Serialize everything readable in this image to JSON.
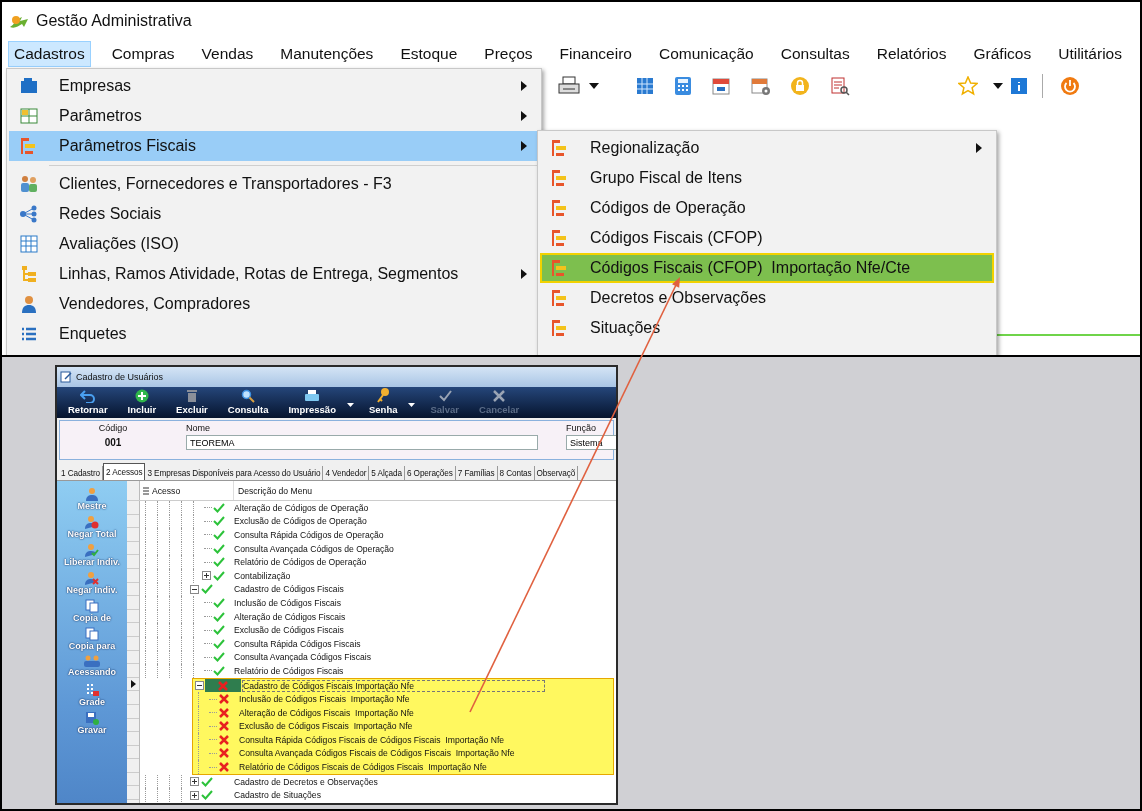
{
  "window": {
    "title": "Gestão Administrativa"
  },
  "menubar": [
    {
      "label": "Cadastros",
      "selected": true
    },
    {
      "label": "Compras",
      "selected": false
    },
    {
      "label": "Vendas",
      "selected": false
    },
    {
      "label": "Manutenções",
      "selected": false
    },
    {
      "label": "Estoque",
      "selected": false
    },
    {
      "label": "Preços",
      "selected": false
    },
    {
      "label": "Financeiro",
      "selected": false
    },
    {
      "label": "Comunicação",
      "selected": false
    },
    {
      "label": "Consultas",
      "selected": false
    },
    {
      "label": "Relatórios",
      "selected": false
    },
    {
      "label": "Gráficos",
      "selected": false
    },
    {
      "label": "Utilitários",
      "selected": false
    }
  ],
  "menu": {
    "items": [
      {
        "kind": "item",
        "label": "Empresas",
        "has_submenu": true,
        "selected": false
      },
      {
        "kind": "item",
        "label": "Parâmetros",
        "has_submenu": true,
        "selected": false
      },
      {
        "kind": "item",
        "label": "Parâmetros Fiscais",
        "has_submenu": true,
        "selected": true
      },
      {
        "kind": "separator"
      },
      {
        "kind": "item",
        "label": "Clientes, Fornecedores e Transportadores - F3",
        "has_submenu": false,
        "selected": false
      },
      {
        "kind": "item",
        "label": "Redes Sociais",
        "has_submenu": false,
        "selected": false
      },
      {
        "kind": "item",
        "label": "Avaliações (ISO)",
        "has_submenu": false,
        "selected": false
      },
      {
        "kind": "item",
        "label": "Linhas, Ramos Atividade, Rotas de Entrega, Segmentos",
        "has_submenu": true,
        "selected": false
      },
      {
        "kind": "item",
        "label": "Vendedores, Compradores",
        "has_submenu": false,
        "selected": false
      },
      {
        "kind": "item",
        "label": "Enquetes",
        "has_submenu": false,
        "selected": false
      }
    ]
  },
  "submenu": {
    "items": [
      {
        "kind": "item",
        "label": "Regionalização",
        "has_submenu": true,
        "selected": false
      },
      {
        "kind": "item",
        "label": "Grupo Fiscal de Itens",
        "has_submenu": false,
        "selected": false
      },
      {
        "kind": "item",
        "label": "Códigos de Operação",
        "has_submenu": false,
        "selected": false
      },
      {
        "kind": "item",
        "label": "Códigos Fiscais (CFOP)",
        "has_submenu": false,
        "selected": false
      },
      {
        "kind": "item",
        "label": "Códigos Fiscais (CFOP)  Importação Nfe/Cte",
        "has_submenu": false,
        "selected": true
      },
      {
        "kind": "item",
        "label": "Decretos e Observações",
        "has_submenu": false,
        "selected": false
      },
      {
        "kind": "item",
        "label": "Situações",
        "has_submenu": false,
        "selected": false
      }
    ]
  },
  "users_window": {
    "title": "Cadastro de Usuários",
    "toolbar": [
      {
        "label": "Retornar",
        "disabled": false,
        "dropdown": false
      },
      {
        "label": "Incluir",
        "disabled": false,
        "dropdown": false
      },
      {
        "label": "Excluir",
        "disabled": false,
        "dropdown": false
      },
      {
        "label": "Consulta",
        "disabled": false,
        "dropdown": false
      },
      {
        "label": "Impressão",
        "disabled": false,
        "dropdown": true
      },
      {
        "label": "Senha",
        "disabled": false,
        "dropdown": true
      },
      {
        "label": "Salvar",
        "disabled": true,
        "dropdown": false
      },
      {
        "label": "Cancelar",
        "disabled": true,
        "dropdown": false
      }
    ],
    "form": {
      "code_label": "Código",
      "code": "001",
      "name_label": "Nome",
      "name": "TEOREMA",
      "role_label": "Função",
      "role": "Sistema"
    },
    "tabs": [
      {
        "label": "1 Cadastro",
        "selected": false
      },
      {
        "label": "2 Acessos",
        "selected": true
      },
      {
        "label": "3 Empresas Disponíveis para Acesso do Usuário",
        "selected": false
      },
      {
        "label": "4 Vendedor",
        "selected": false
      },
      {
        "label": "5 Alçada",
        "selected": false
      },
      {
        "label": "6 Operações",
        "selected": false
      },
      {
        "label": "7 Famílias",
        "selected": false
      },
      {
        "label": "8 Contas",
        "selected": false
      },
      {
        "label": "Observaçõ",
        "selected": false
      }
    ],
    "actions": [
      "Mestre",
      "Negar Total",
      "Liberar Indiv.",
      "Negar Indiv.",
      "Copia de",
      "Copia para",
      "Acessando",
      "Grade",
      "Gravar"
    ],
    "grid": {
      "columns": [
        "Acesso",
        "Descrição do Menu"
      ],
      "tree": [
        {
          "kind": "continuation",
          "highlighted": false,
          "children": [
            {
              "kind": "node",
              "label": "Alteração de Códigos de Operação",
              "allowed": true,
              "selected": false
            },
            {
              "kind": "node",
              "label": "Exclusão de Códigos de Operação",
              "allowed": true,
              "selected": false
            },
            {
              "kind": "node",
              "label": "Consulta Rápida Códigos de Operação",
              "allowed": true,
              "selected": false
            },
            {
              "kind": "node",
              "label": "Consulta Avançada Códigos de Operação",
              "allowed": true,
              "selected": false
            },
            {
              "kind": "node",
              "label": "Relatório de Códigos de Operação",
              "allowed": true,
              "selected": false
            },
            {
              "kind": "node",
              "label": "Contabilização",
              "allowed": true,
              "expanded": false,
              "selected": false
            }
          ]
        },
        {
          "kind": "node",
          "label": "Cadastro de Códigos Fiscais",
          "allowed": true,
          "expanded": true,
          "highlighted": false,
          "selected": false,
          "children": [
            {
              "kind": "node",
              "label": "Inclusão de Códigos Fiscais",
              "allowed": true,
              "selected": false
            },
            {
              "kind": "node",
              "label": "Alteração de Códigos Fiscais",
              "allowed": true,
              "selected": false
            },
            {
              "kind": "node",
              "label": "Exclusão de Códigos Fiscais",
              "allowed": true,
              "selected": false
            },
            {
              "kind": "node",
              "label": "Consulta Rápida Códigos Fiscais",
              "allowed": true,
              "selected": false
            },
            {
              "kind": "node",
              "label": "Consulta Avançada Códigos Fiscais",
              "allowed": true,
              "selected": false
            },
            {
              "kind": "node",
              "label": "Relatório de Códigos Fiscais",
              "allowed": true,
              "selected": false
            }
          ]
        },
        {
          "kind": "node",
          "label": "Cadastro de Códigos Fiscais Importação Nfe",
          "allowed": false,
          "expanded": true,
          "highlighted": true,
          "selected": true,
          "children": [
            {
              "kind": "node",
              "label": "Inclusão de Códigos Fiscais  Importação Nfe",
              "allowed": false,
              "selected": false
            },
            {
              "kind": "node",
              "label": "Alteração de Códigos Fiscais  Importação Nfe",
              "allowed": false,
              "selected": false
            },
            {
              "kind": "node",
              "label": "Exclusão de Códigos Fiscais  Importação Nfe",
              "allowed": false,
              "selected": false
            },
            {
              "kind": "node",
              "label": "Consulta Rápida Códigos Fiscais de Códigos Fiscais  Importação Nfe",
              "allowed": false,
              "selected": false
            },
            {
              "kind": "node",
              "label": "Consulta Avançada Códigos Fiscais de Códigos Fiscais  Importação Nfe",
              "allowed": false,
              "selected": false
            },
            {
              "kind": "node",
              "label": "Relatório de Códigos Fiscais de Códigos Fiscais  Importação Nfe",
              "allowed": false,
              "selected": false
            }
          ]
        },
        {
          "kind": "node",
          "label": "Cadastro de Decretos e Observações",
          "allowed": true,
          "expanded": false,
          "highlighted": false,
          "selected": false
        },
        {
          "kind": "node",
          "label": "Cadastro de Situações",
          "allowed": true,
          "expanded": false,
          "highlighted": false,
          "selected": false
        }
      ]
    }
  }
}
